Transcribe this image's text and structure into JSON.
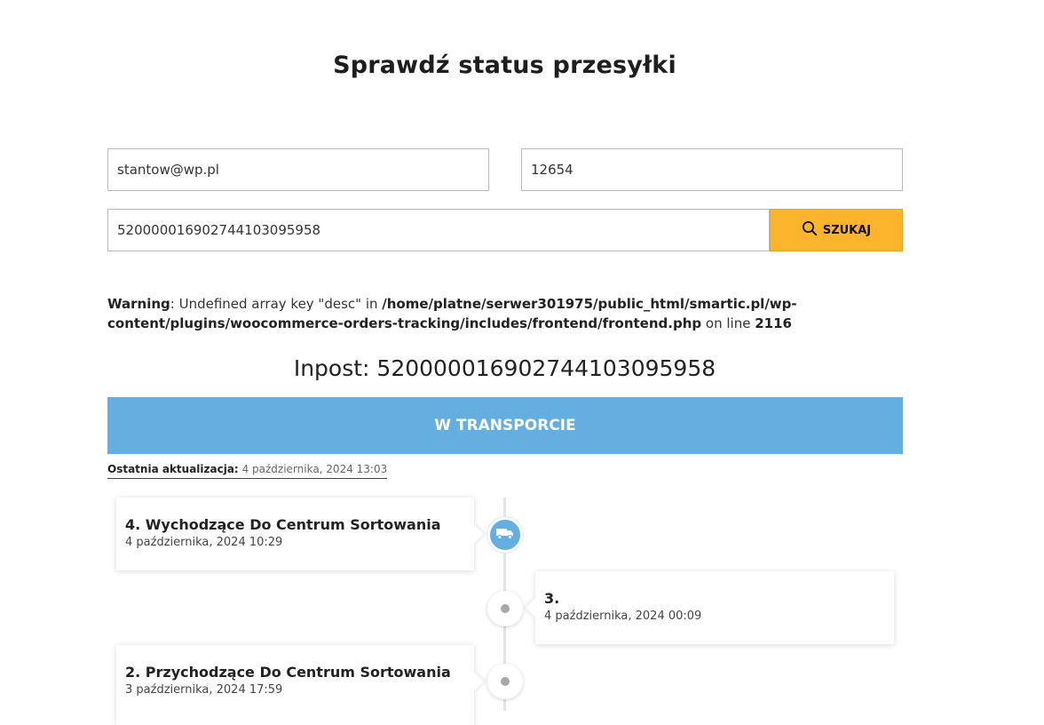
{
  "page": {
    "title": "Sprawdź status przesyłki"
  },
  "form": {
    "email_value": "stantow@wp.pl",
    "order_value": "12654",
    "tracking_value": "520000016902744103095958",
    "search_label": "SZUKAJ",
    "search_icon": "search-icon"
  },
  "warning": {
    "label": "Warning",
    "message": ": Undefined array key \"desc\" in ",
    "path": "/home/platne/serwer301975/public_html/smartic.pl/wp-content/plugins/woocommerce-orders-tracking/includes/frontend/frontend.php",
    "on_line": " on line ",
    "line": "2116"
  },
  "shipment": {
    "carrier_heading": "Inpost: 520000016902744103095958",
    "status": "W TRANSPORCIE",
    "status_color": "#64aee0",
    "last_update_label": "Ostatnia aktualizacja:",
    "last_update_value": "4 października, 2024 13:03"
  },
  "timeline": {
    "events": [
      {
        "title": "4. Wychodzące Do Centrum Sortowania",
        "date": "4 października, 2024 10:29",
        "icon": "truck-icon"
      },
      {
        "title": "3.",
        "date": "4 października, 2024 00:09",
        "icon": "dot-icon"
      },
      {
        "title": "2. Przychodzące Do Centrum Sortowania",
        "date": "3 października, 2024 17:59",
        "icon": "dot-icon"
      }
    ]
  }
}
